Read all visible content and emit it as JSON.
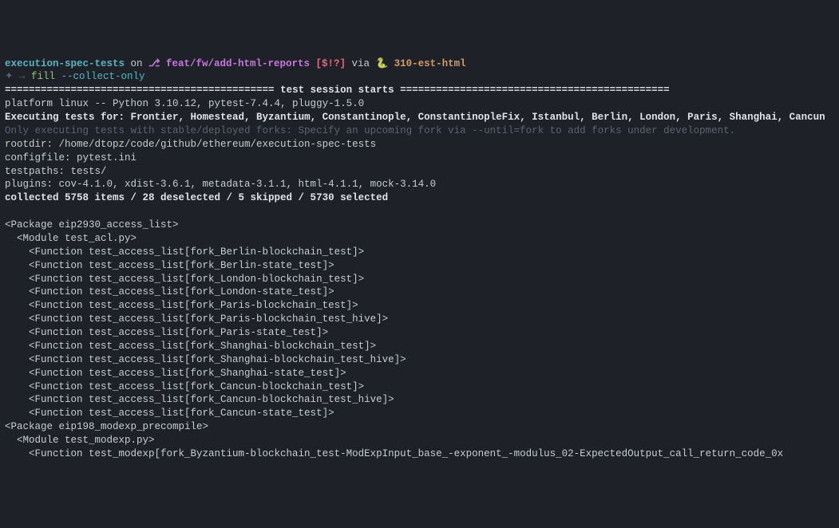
{
  "prompt": {
    "repo": "execution-spec-tests",
    "on": " on ",
    "branch_icon": "⎇ ",
    "branch": "feat/fw/add-html-reports",
    "vcs_status": " [$!?] ",
    "via": "via ",
    "py_icon": "🐍 ",
    "env": "310-est-html"
  },
  "cmd": {
    "bullets": "✦ → ",
    "name": "fill",
    "args": " --collect-only"
  },
  "session": {
    "header_left": "============================================= ",
    "header_title": "test session starts",
    "header_right": " =============================================",
    "platform": "platform linux -- Python 3.10.12, pytest-7.4.4, pluggy-1.5.0",
    "exec_label": "Executing tests for: ",
    "exec_forks": "Frontier, Homestead, Byzantium, Constantinople, ConstantinopleFix, Istanbul, Berlin, London, Paris, Shanghai, Cancun",
    "stable_note": "Only executing tests with stable/deployed forks: Specify an upcoming fork via --until=fork to add forks under development.",
    "rootdir": "rootdir: /home/dtopz/code/github/ethereum/execution-spec-tests",
    "configfile": "configfile: pytest.ini",
    "testpaths": "testpaths: tests/",
    "plugins": "plugins: cov-4.1.0, xdist-3.6.1, metadata-3.1.1, html-4.1.1, mock-3.14.0",
    "collected": "collected 5758 items / 28 deselected / 5 skipped / 5730 selected"
  },
  "tree": {
    "pkg1": "<Package eip2930_access_list>",
    "mod1": "  <Module test_acl.py>",
    "fn": [
      "    <Function test_access_list[fork_Berlin-blockchain_test]>",
      "    <Function test_access_list[fork_Berlin-state_test]>",
      "    <Function test_access_list[fork_London-blockchain_test]>",
      "    <Function test_access_list[fork_London-state_test]>",
      "    <Function test_access_list[fork_Paris-blockchain_test]>",
      "    <Function test_access_list[fork_Paris-blockchain_test_hive]>",
      "    <Function test_access_list[fork_Paris-state_test]>",
      "    <Function test_access_list[fork_Shanghai-blockchain_test]>",
      "    <Function test_access_list[fork_Shanghai-blockchain_test_hive]>",
      "    <Function test_access_list[fork_Shanghai-state_test]>",
      "    <Function test_access_list[fork_Cancun-blockchain_test]>",
      "    <Function test_access_list[fork_Cancun-blockchain_test_hive]>",
      "    <Function test_access_list[fork_Cancun-state_test]>"
    ],
    "pkg2": "<Package eip198_modexp_precompile>",
    "mod2": "  <Module test_modexp.py>",
    "fn2": "    <Function test_modexp[fork_Byzantium-blockchain_test-ModExpInput_base_-exponent_-modulus_02-ExpectedOutput_call_return_code_0x"
  }
}
